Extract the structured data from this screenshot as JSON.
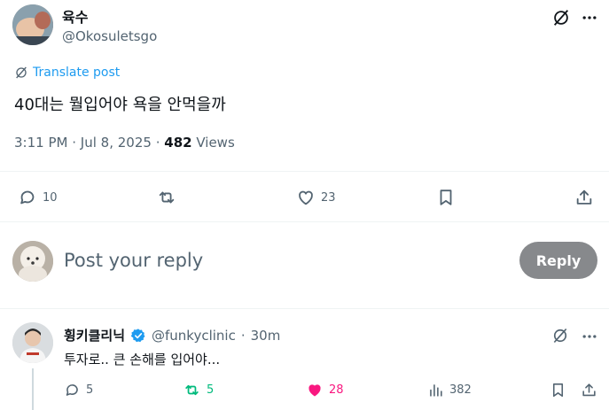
{
  "post": {
    "display_name": "육수",
    "handle": "@Okosuletsgo",
    "translate_label": "Translate post",
    "text": "40대는 뭘입어야 욕을 안먹을까",
    "time": "3:11 PM",
    "separator": "·",
    "date": "Jul 8, 2025",
    "views_count": "482",
    "views_label": "Views",
    "actions": {
      "replies": "10",
      "reposts": "",
      "likes": "23"
    }
  },
  "composer": {
    "placeholder": "Post your reply",
    "button_label": "Reply"
  },
  "reply": {
    "display_name": "휭키클리닉",
    "handle": "@funkyclinic",
    "dot": "·",
    "time": "30m",
    "text": "투자로.. 큰 손해를 입어야...",
    "actions": {
      "replies": "5",
      "reposts": "5",
      "likes": "28",
      "views": "382"
    }
  },
  "colors": {
    "accent": "#1d9bf0",
    "verified": "#1d9bf0",
    "repost_active": "#00ba7c",
    "like_active": "#f91880",
    "muted": "#536471",
    "reply_button": "#87898c"
  },
  "icons": [
    "grok-icon",
    "more-icon",
    "translate-icon",
    "reply-icon",
    "repost-icon",
    "like-icon",
    "bookmark-icon",
    "share-icon",
    "views-icon",
    "verified-icon"
  ]
}
